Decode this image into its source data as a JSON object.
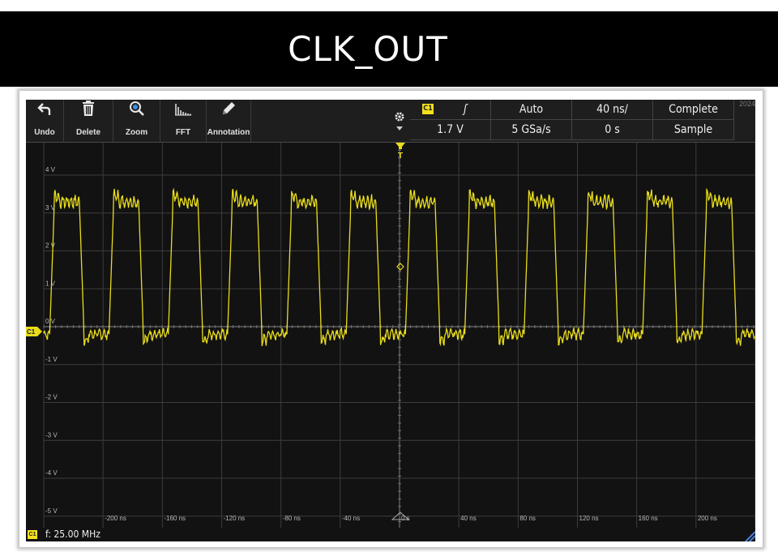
{
  "title": "CLK_OUT",
  "toolbar": {
    "tools": [
      {
        "label": "Undo",
        "icon": "undo-icon"
      },
      {
        "label": "Delete",
        "icon": "trash-icon"
      },
      {
        "label": "Zoom",
        "icon": "zoom-icon"
      },
      {
        "label": "FFT",
        "icon": "fft-icon"
      },
      {
        "label": "Annotation",
        "icon": "pencil-icon"
      }
    ],
    "settings_icon": "gear-icon"
  },
  "trigger_panel": {
    "channel": "C1",
    "edge": "ʃ",
    "mode": "Auto",
    "timebase": "40 ns/",
    "acq_state": "Complete",
    "level": "1.7 V",
    "sample_rate": "5 GSa/s",
    "position": "0 s",
    "acq_mode": "Sample",
    "year": "2024"
  },
  "axes": {
    "y_labels": [
      "4 V",
      "3 V",
      "2 V",
      "1 V",
      "0 V",
      "-1 V",
      "-2 V",
      "-3 V",
      "-4 V",
      "-5 V"
    ],
    "x_labels": [
      "-200 ns",
      "-160 ns",
      "-120 ns",
      "-80 ns",
      "-40 ns",
      "0 s",
      "40 ns",
      "80 ns",
      "120 ns",
      "160 ns",
      "200 ns"
    ]
  },
  "channel_marker": "C1",
  "trigger_marker": "T",
  "status": {
    "channel": "C1",
    "frequency": "f: 25.00 MHz"
  },
  "colors": {
    "trace": "#e8dc1c",
    "badge": "#f5e21a",
    "grid": "#3c3c3c",
    "background": "#121212"
  },
  "chart_data": {
    "type": "line",
    "x_unit": "ns",
    "y_unit": "V",
    "xlim": [
      -240,
      240
    ],
    "ylim": [
      -5,
      4.5
    ],
    "grid": true,
    "series": [
      {
        "waveform": "square",
        "frequency_mhz": 25.0,
        "high_v": 3.3,
        "low_v": -0.2,
        "first_rising_edge_ns": -196,
        "period_ns": 40
      }
    ]
  }
}
